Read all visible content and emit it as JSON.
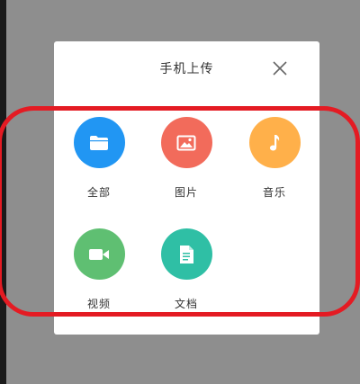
{
  "dialog": {
    "title": "手机上传",
    "close_icon": "close-icon"
  },
  "options": [
    {
      "label": "全部",
      "icon": "folder-icon",
      "color": "#2196f3"
    },
    {
      "label": "图片",
      "icon": "image-icon",
      "color": "#f26b5b"
    },
    {
      "label": "音乐",
      "icon": "music-note-icon",
      "color": "#ffb04a"
    },
    {
      "label": "视频",
      "icon": "video-camera-icon",
      "color": "#5fbf72"
    },
    {
      "label": "文档",
      "icon": "document-icon",
      "color": "#2fbfa5"
    }
  ],
  "annotation": {
    "outline_color": "#e41b23"
  },
  "backdrop_color": "#8e8e8e"
}
